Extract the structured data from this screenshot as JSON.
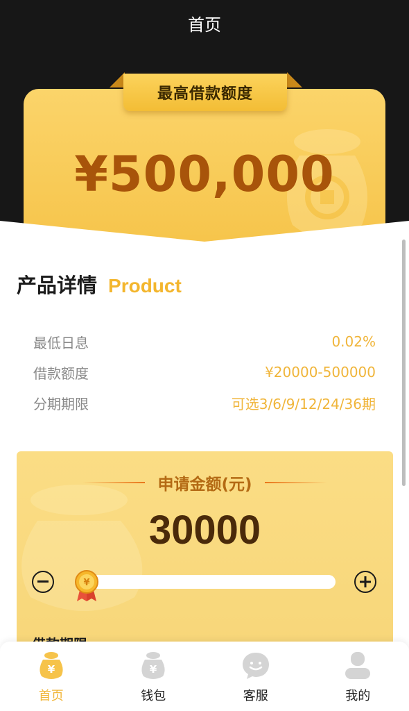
{
  "header": {
    "title": "首页"
  },
  "hero": {
    "badge_text": "最高借款额度",
    "amount": "¥500,000"
  },
  "product": {
    "title_cn": "产品详情",
    "title_en": "Product",
    "rows": [
      {
        "label": "最低日息",
        "value": "0.02%"
      },
      {
        "label": "借款额度",
        "value": "¥20000-500000"
      },
      {
        "label": "分期期限",
        "value": "可选3/6/9/12/24/36期"
      }
    ]
  },
  "apply": {
    "title": "申请金额(元)",
    "amount": "30000",
    "slider_fraction": 0.02,
    "term_label": "借款期限"
  },
  "tabs": [
    {
      "label": "首页",
      "icon": "money-bag-icon",
      "active": true
    },
    {
      "label": "钱包",
      "icon": "wallet-icon",
      "active": false
    },
    {
      "label": "客服",
      "icon": "chat-bubble-icon",
      "active": false
    },
    {
      "label": "我的",
      "icon": "user-icon",
      "active": false
    }
  ],
  "colors": {
    "accent": "#f1b63a",
    "hero_amount": "#a8540a",
    "header_bg": "#171717"
  }
}
